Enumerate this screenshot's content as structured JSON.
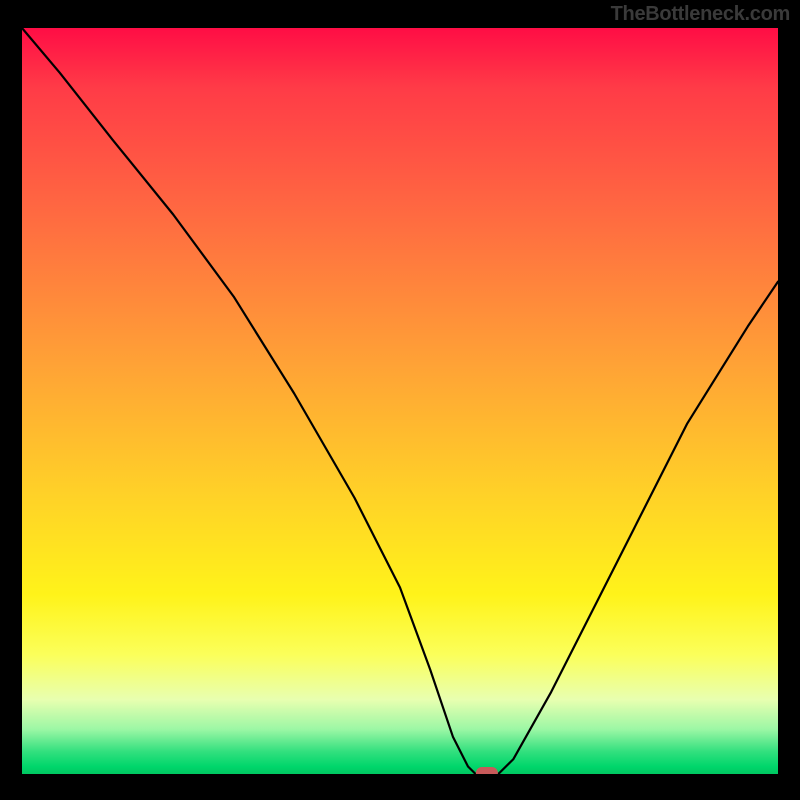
{
  "attribution": "TheBottleneck.com",
  "chart_data": {
    "type": "line",
    "title": "",
    "xlabel": "",
    "ylabel": "",
    "xlim": [
      0,
      100
    ],
    "ylim": [
      0,
      100
    ],
    "series": [
      {
        "name": "bottleneck-curve",
        "x": [
          0,
          5,
          12,
          20,
          28,
          36,
          44,
          50,
          54,
          57,
          59,
          60,
          63,
          65,
          70,
          78,
          88,
          96,
          100
        ],
        "y": [
          100,
          94,
          85,
          75,
          64,
          51,
          37,
          25,
          14,
          5,
          1,
          0,
          0,
          2,
          11,
          27,
          47,
          60,
          66
        ]
      }
    ],
    "marker": {
      "x": 61.5,
      "y": 0
    },
    "background_gradient": {
      "stops": [
        {
          "pct": 0,
          "color": "#ff0d45"
        },
        {
          "pct": 8,
          "color": "#ff3b47"
        },
        {
          "pct": 25,
          "color": "#ff6a41"
        },
        {
          "pct": 45,
          "color": "#ffa236"
        },
        {
          "pct": 62,
          "color": "#ffd028"
        },
        {
          "pct": 76,
          "color": "#fff31a"
        },
        {
          "pct": 84,
          "color": "#fbff5a"
        },
        {
          "pct": 90,
          "color": "#e8ffb0"
        },
        {
          "pct": 94,
          "color": "#9cf7a5"
        },
        {
          "pct": 97,
          "color": "#32e07e"
        },
        {
          "pct": 99,
          "color": "#00d66b"
        },
        {
          "pct": 100,
          "color": "#00c761"
        }
      ]
    }
  }
}
